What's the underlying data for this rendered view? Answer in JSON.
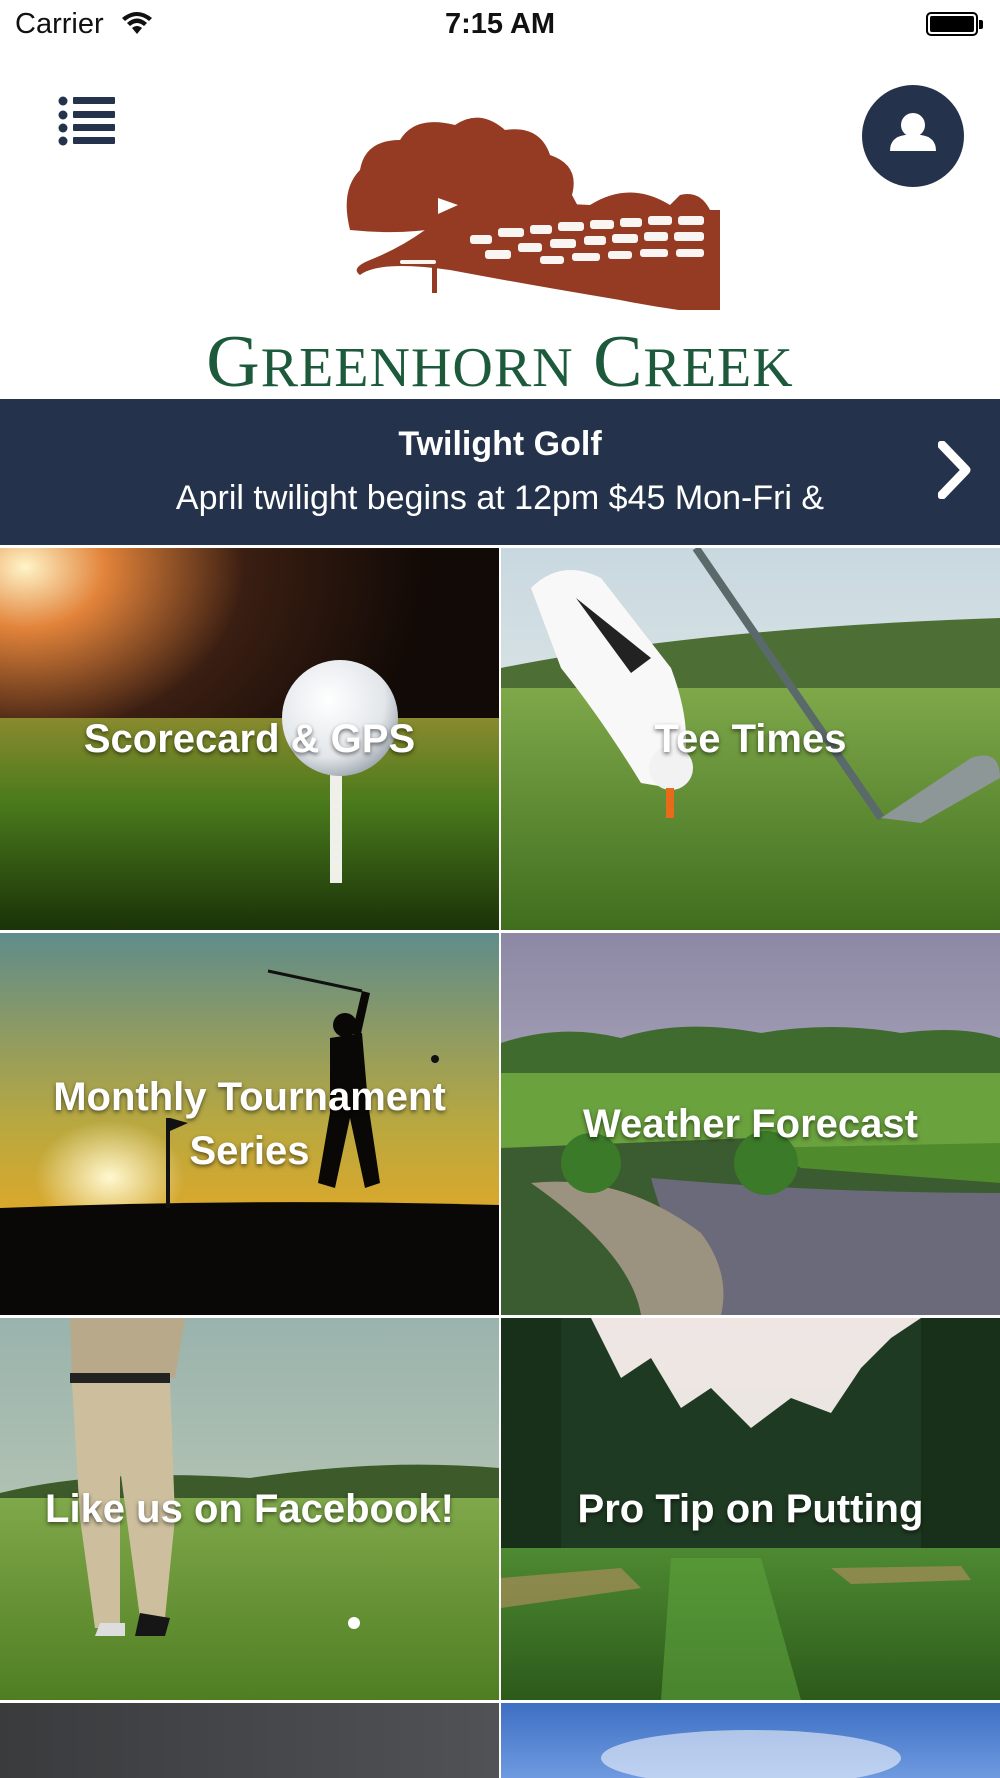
{
  "status_bar": {
    "carrier": "Carrier",
    "time": "7:15 AM",
    "icons": [
      "wifi-icon",
      "battery-icon"
    ]
  },
  "header": {
    "menu_icon": "list-icon",
    "profile_icon": "user-icon",
    "logo": {
      "text_first": "G",
      "text_first_rest": "REENHORN",
      "text_second": "C",
      "text_second_rest": "REEK"
    }
  },
  "banner": {
    "title": "Twilight Golf",
    "text": "April twilight begins at 12pm $45 Mon-Fri &",
    "chevron_icon": "chevron-right-icon"
  },
  "tiles": [
    {
      "label": "Scorecard & GPS"
    },
    {
      "label": "Tee Times"
    },
    {
      "label": "Monthly Tournament Series"
    },
    {
      "label": "Weather Forecast"
    },
    {
      "label": "Like us on Facebook!"
    },
    {
      "label": "Pro Tip on Putting"
    }
  ],
  "colors": {
    "navy": "#24334b",
    "logo_green": "#1d5a3c",
    "logo_brown": "#953b24"
  }
}
